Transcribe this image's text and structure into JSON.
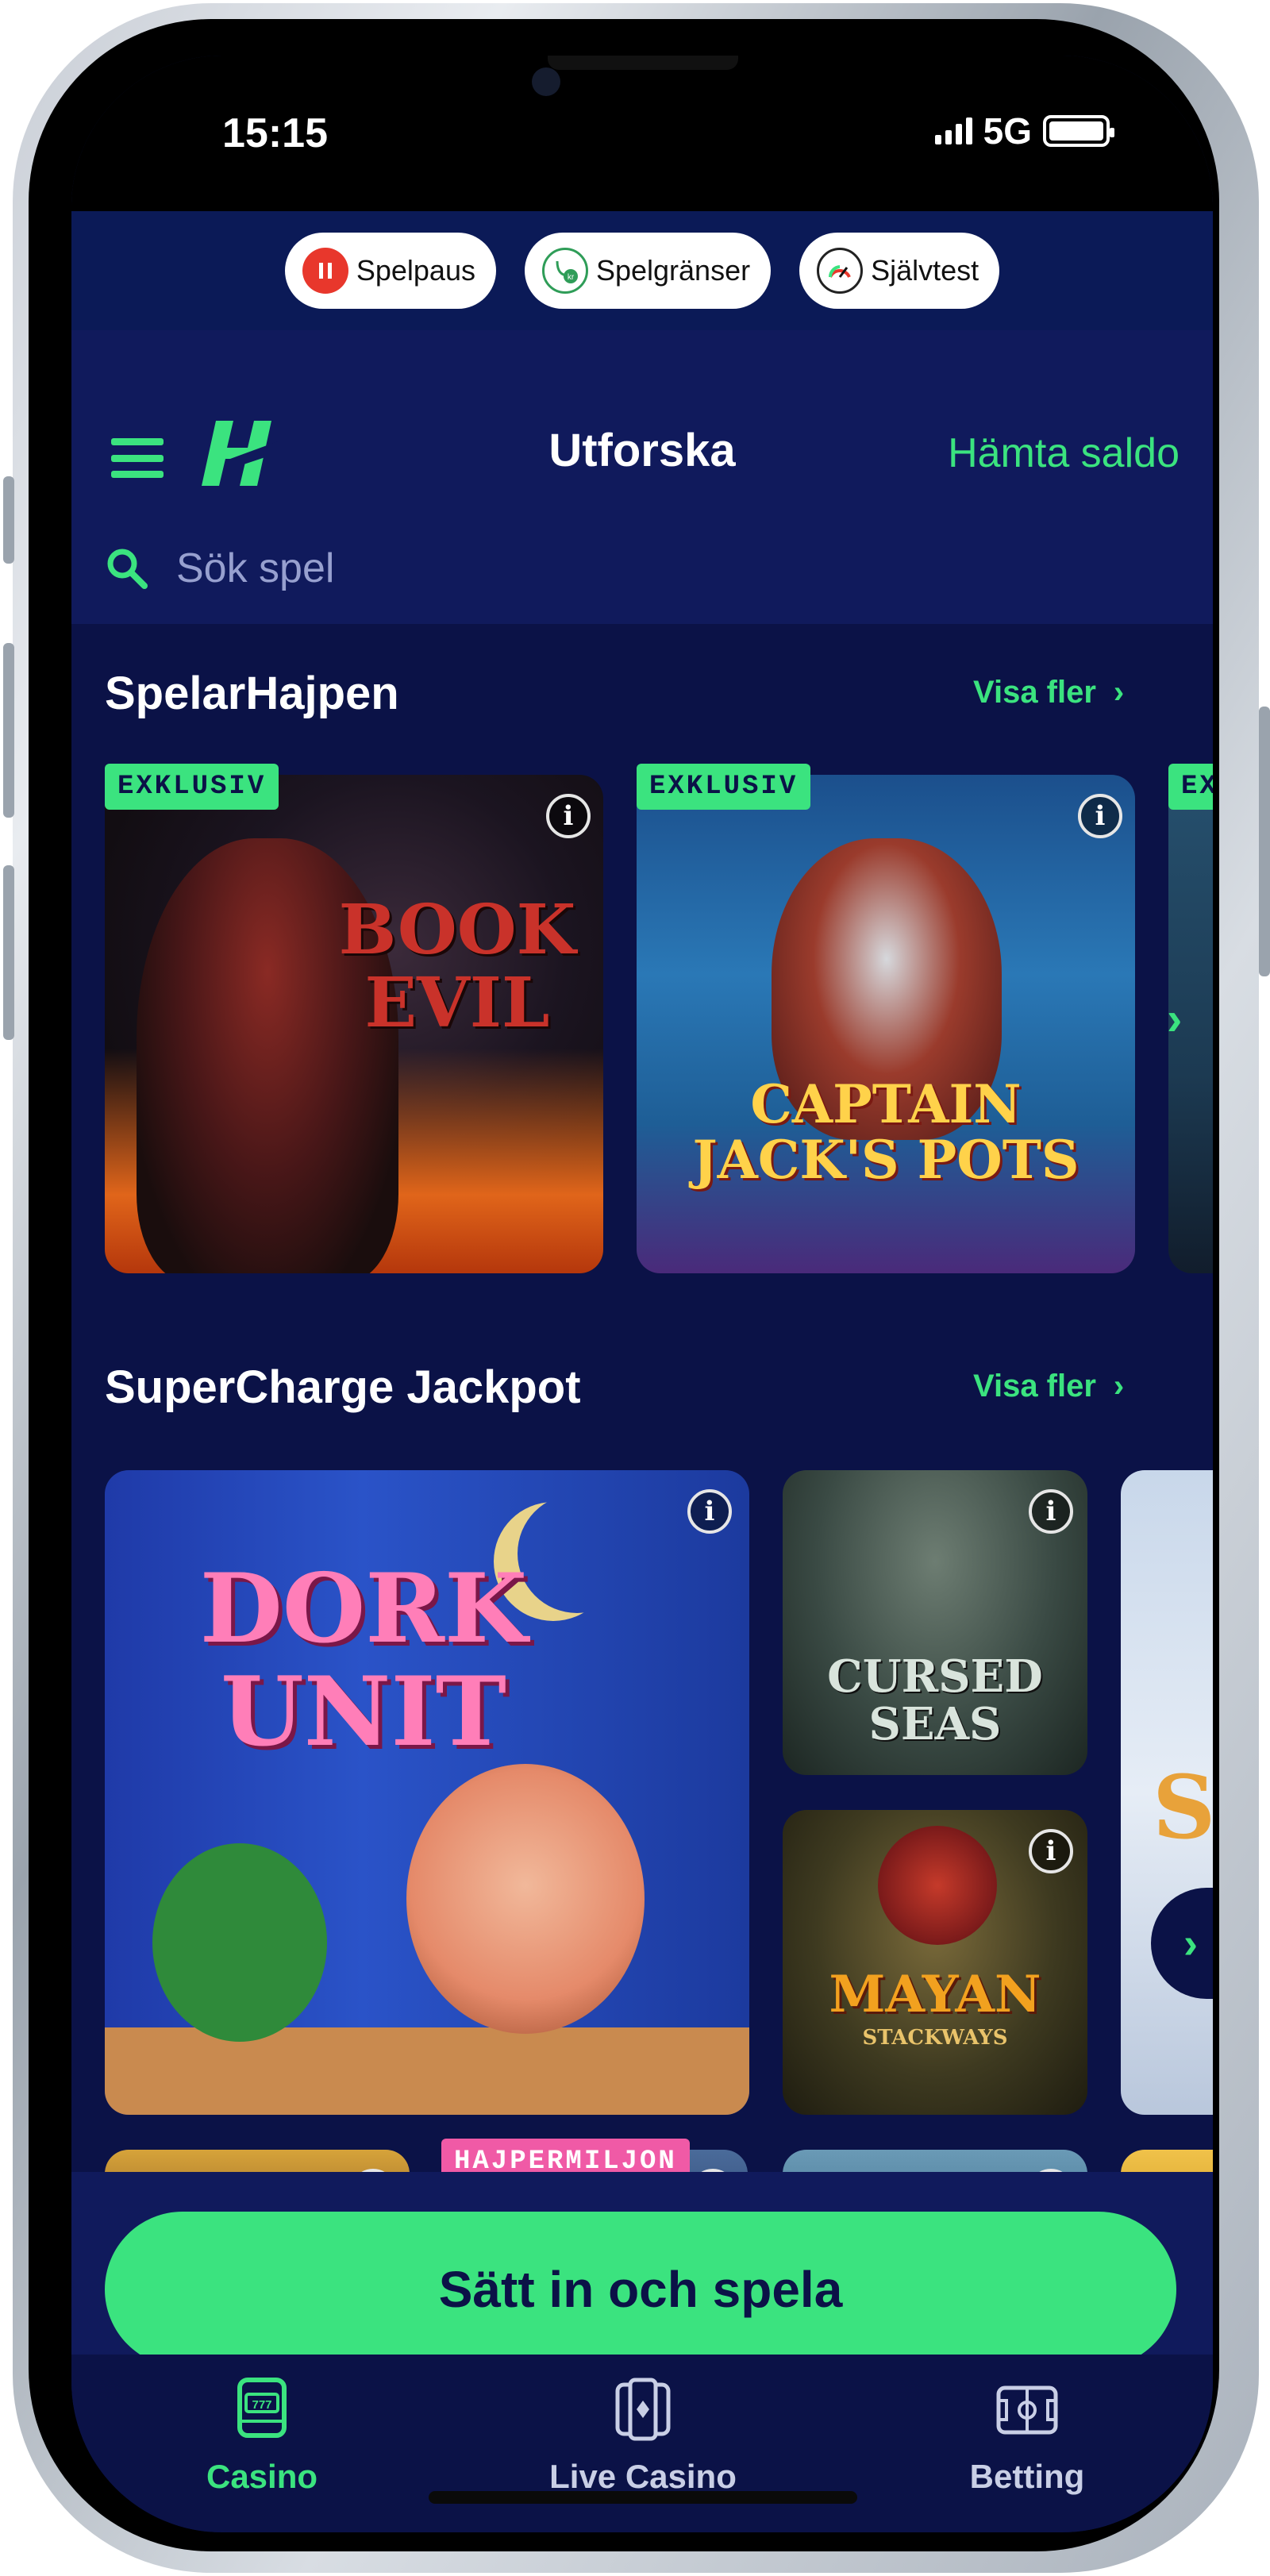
{
  "status_bar": {
    "time": "15:15",
    "network": "5G"
  },
  "rg_bar": {
    "buttons": [
      {
        "label": "Spelpaus",
        "icon": "pause-icon"
      },
      {
        "label": "Spelgränser",
        "icon": "limits-icon"
      },
      {
        "label": "Självtest",
        "icon": "gauge-icon"
      }
    ]
  },
  "header": {
    "title": "Utforska",
    "balance_link": "Hämta saldo",
    "menu_icon": "hamburger-menu-icon",
    "logo_icon": "brand-logo-icon"
  },
  "search": {
    "placeholder": "Sök spel",
    "icon": "search-icon"
  },
  "sections": [
    {
      "title": "SpelarHajpen",
      "more_label": "Visa fler",
      "games": [
        {
          "name": "BOOK OF EVIL",
          "tag": "EXKLUSIV"
        },
        {
          "name": "CAPTAIN JACK'S POTS",
          "tag": "EXKLUSIV"
        },
        {
          "name": "",
          "tag": "EX"
        }
      ]
    },
    {
      "title": "SuperCharge Jackpot",
      "more_label": "Visa fler",
      "games": [
        {
          "name": "DORK UNIT",
          "tag": ""
        },
        {
          "name": "CURSED SEAS",
          "tag": ""
        },
        {
          "name": "MAYAN STACKWAYS",
          "tag": ""
        },
        {
          "name": "S",
          "tag": ""
        }
      ]
    }
  ],
  "bottom_row": {
    "tag": "HAJPERMILJON"
  },
  "cta": {
    "label": "Sätt in och spela"
  },
  "bottom_nav": [
    {
      "label": "Casino",
      "icon": "slot-machine-icon",
      "active": true
    },
    {
      "label": "Live Casino",
      "icon": "playing-card-icon",
      "active": false
    },
    {
      "label": "Betting",
      "icon": "football-field-icon",
      "active": false
    }
  ],
  "colors": {
    "accent": "#3be37f",
    "background": "#0b1247",
    "header": "#101a5c",
    "tag_pink": "#f05aa6"
  }
}
